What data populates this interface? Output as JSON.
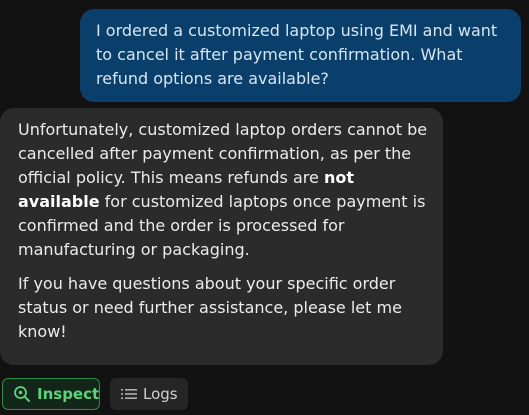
{
  "messages": {
    "user": "I ordered a customized laptop using EMI and want to cancel it after payment confirmation. What refund options are available?",
    "assistant": {
      "p1_before": "Unfortunately, customized laptop orders cannot be cancelled after payment confirmation, as per the official policy. This means refunds are ",
      "p1_bold": "not available",
      "p1_after": " for customized laptops once payment is confirmed and the order is processed for manufacturing or packaging.",
      "p2": "If you have questions about your specific order status or need further assistance, please let me know!"
    }
  },
  "actions": {
    "inspect_label": "Inspect",
    "logs_label": "Logs"
  },
  "icons": {
    "inspect": "magnifier-icon",
    "logs": "list-icon"
  },
  "colors": {
    "user_bubble": "#0a3f6c",
    "assistant_bubble": "#2b2b2b",
    "inspect_accent": "#5ad47a"
  }
}
